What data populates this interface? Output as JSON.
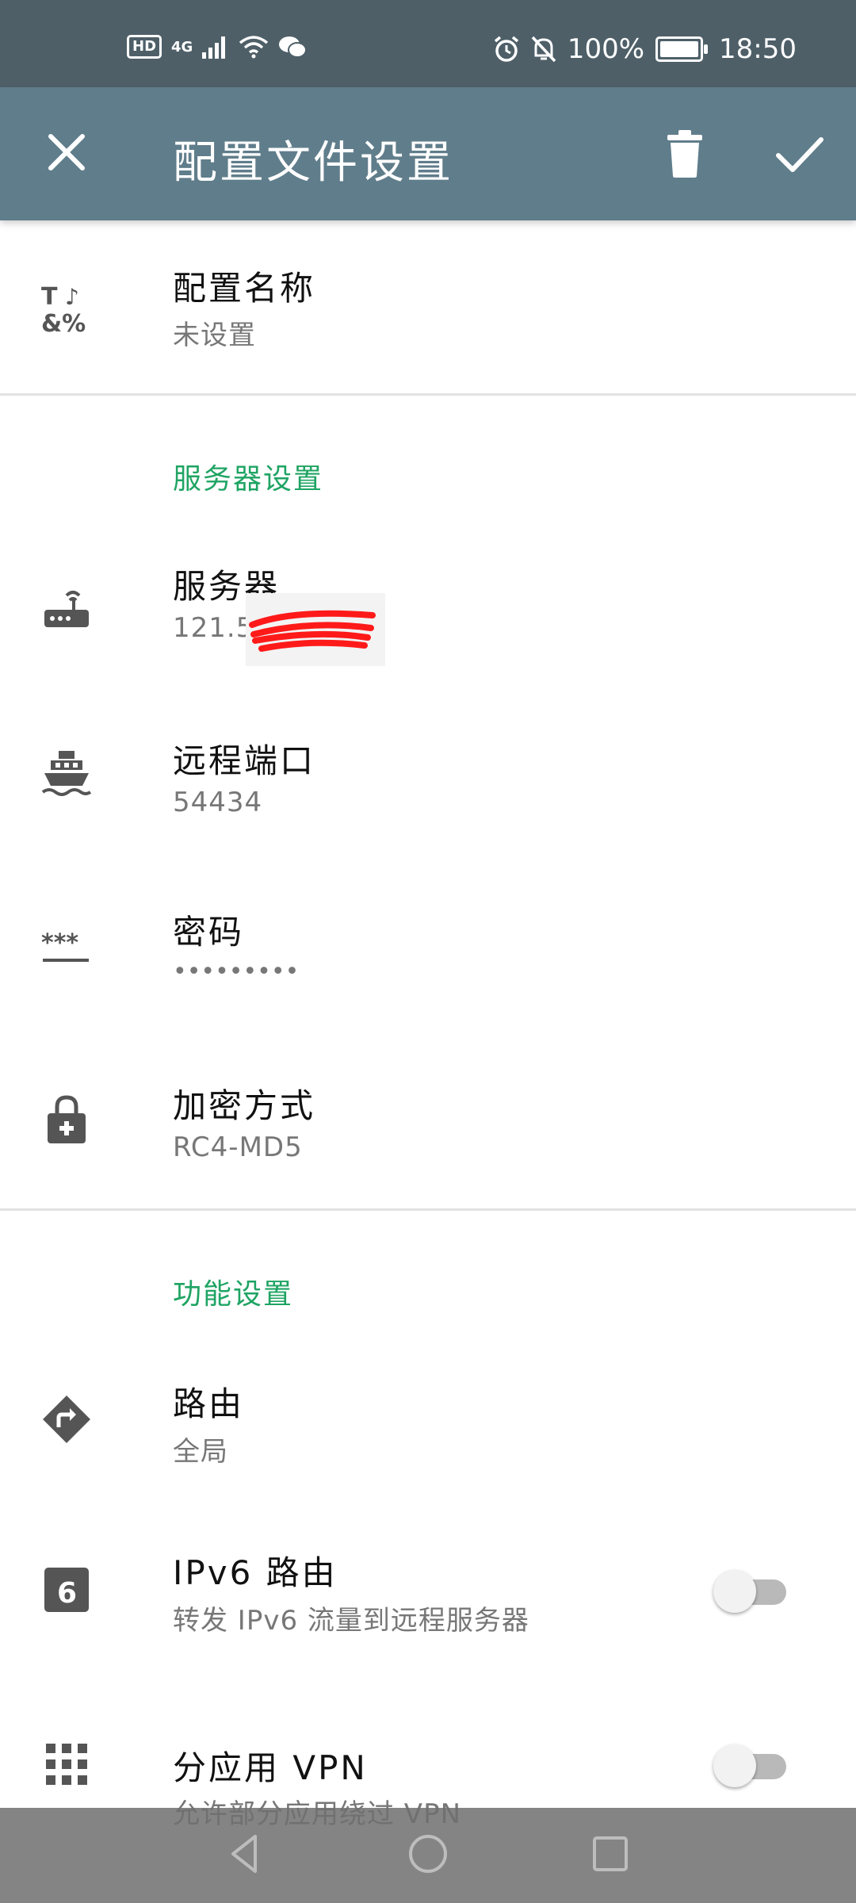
{
  "status_bar": {
    "hd": "HD",
    "network": "4G",
    "battery": "100%",
    "time": "18:50"
  },
  "app_bar": {
    "title": "配置文件设置",
    "close_icon": "close-icon",
    "delete_icon": "trash-icon",
    "confirm_icon": "check-icon"
  },
  "profile": {
    "name_label": "配置名称",
    "name_value": "未设置"
  },
  "server_section": {
    "header": "服务器设置",
    "items": [
      {
        "label": "服务器",
        "value": "121.5",
        "icon": "router-icon"
      },
      {
        "label": "远程端口",
        "value": "54434",
        "icon": "ship-icon"
      },
      {
        "label": "密码",
        "value": "•••••••••",
        "icon": "password-icon"
      },
      {
        "label": "加密方式",
        "value": "RC4-MD5",
        "icon": "lock-icon"
      }
    ]
  },
  "feature_section": {
    "header": "功能设置",
    "items": [
      {
        "label": "路由",
        "value": "全局",
        "icon": "route-icon"
      },
      {
        "label": "IPv6 路由",
        "value": "转发 IPv6 流量到远程服务器",
        "icon": "ipv6-icon",
        "toggle_on": false
      },
      {
        "label": "分应用 VPN",
        "value": "允许部分应用绕过 VPN",
        "icon": "apps-grid-icon",
        "toggle_on": false
      },
      {
        "label": ""
      }
    ]
  },
  "colors": {
    "status_bar": "#4e5f68",
    "app_bar": "#607d8b",
    "section_header": "#1fa463",
    "redaction": "#ff1a1a"
  }
}
